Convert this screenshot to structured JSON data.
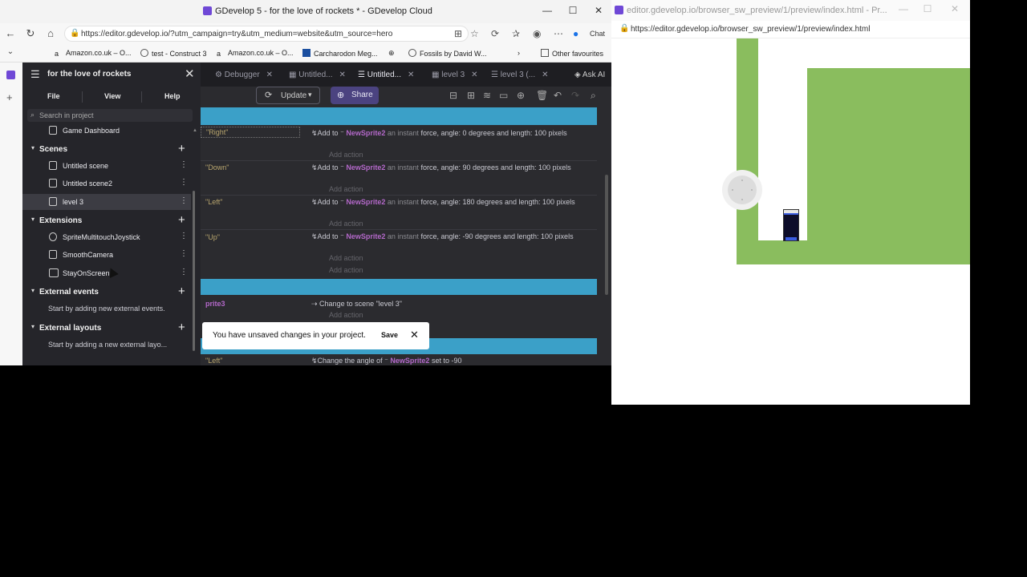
{
  "left_window": {
    "title": "GDevelop 5 - for the love of rockets * - GDevelop Cloud",
    "url": "https://editor.gdevelop.io/?utm_campaign=try&utm_medium=website&utm_source=hero",
    "chat_label": "Chat",
    "bookmarks": [
      "Amazon.co.uk – O...",
      "test - Construct 3",
      "Amazon.co.uk – O...",
      "Carcharodon Meg...",
      "Fossils by David W...",
      "Other favourites"
    ]
  },
  "editor": {
    "tabs": [
      "Debugger",
      "Untitled...",
      "Untitled...",
      "level 3",
      "level 3 (..."
    ],
    "ask_ai": "Ask AI",
    "update_label": "Update",
    "share_label": "Share",
    "events": [
      {
        "condition": "\"Right\"",
        "pre": "Add to",
        "object": "NewSprite2",
        "kw": "an instant",
        "rest": "force, angle: 0 degrees and length: 100 pixels",
        "add_action": "Add action"
      },
      {
        "condition": "\"Down\"",
        "pre": "Add to",
        "object": "NewSprite2",
        "kw": "an instant",
        "rest": "force, angle: 90 degrees and length: 100 pixels",
        "add_action": "Add action"
      },
      {
        "condition": "\"Left\"",
        "pre": "Add to",
        "object": "NewSprite2",
        "kw": "an instant",
        "rest": "force, angle: 180 degrees and length: 100 pixels",
        "add_action": "Add action"
      },
      {
        "condition": "\"Up\"",
        "pre": "Add to",
        "object": "NewSprite2",
        "kw": "an instant",
        "rest": "force, angle: -90 degrees and length: 100 pixels",
        "add_action": "Add action"
      }
    ],
    "trailing_add_action": "Add action",
    "scene_event": {
      "condition": "prite3",
      "action": "Change to scene \"level 3\"",
      "add_action": "Add action"
    },
    "bottom_event": {
      "condition": "\"Left\"",
      "pre": "Change the angle of",
      "object": "NewSprite2",
      "rest": "set to -90"
    }
  },
  "drawer": {
    "project_title": "for the love of rockets",
    "menu": [
      "File",
      "View",
      "Help"
    ],
    "search_placeholder": "Search in project",
    "game_dashboard": "Game Dashboard",
    "scenes_header": "Scenes",
    "scenes": [
      "Untitled scene",
      "Untitled scene2",
      "level 3"
    ],
    "extensions_header": "Extensions",
    "extensions": [
      "SpriteMultitouchJoystick",
      "SmoothCamera",
      "StayOnScreen"
    ],
    "external_events_header": "External events",
    "external_events_hint": "Start by adding new external events.",
    "external_layouts_header": "External layouts",
    "external_layouts_hint": "Start by adding a new external layo..."
  },
  "snackbar": {
    "message": "You have unsaved changes in your project.",
    "save": "Save"
  },
  "right_window": {
    "title": "editor.gdevelop.io/browser_sw_preview/1/preview/index.html - Pr...",
    "url": "https://editor.gdevelop.io/browser_sw_preview/1/preview/index.html"
  },
  "colors": {
    "grass": "#8abd5e",
    "event_bar": "#3ba0c8",
    "object_name": "#b368c9",
    "share_button": "#4b4380"
  }
}
